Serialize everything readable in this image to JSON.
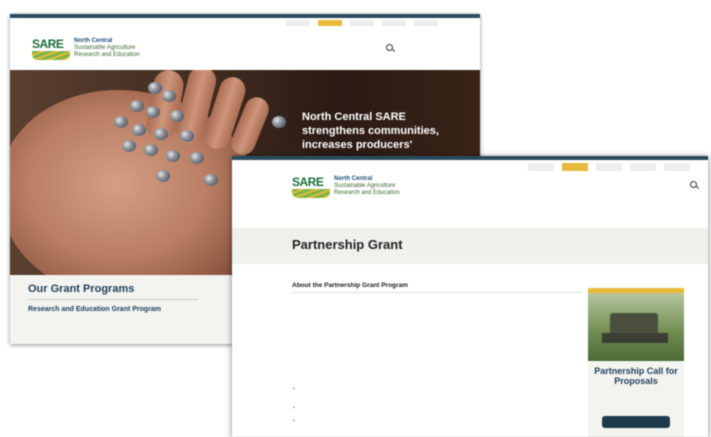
{
  "back_window": {
    "utility_tabs": [
      "",
      "",
      "",
      "",
      ""
    ],
    "logo": {
      "mark": "SARE",
      "line1": "North Central",
      "line2": "Sustainable Agriculture",
      "line3": "Research and Education"
    },
    "search": {
      "label1": "",
      "label2": ""
    },
    "nav_items": [
      "",
      "",
      "",
      "",
      ""
    ],
    "hero_text": "North Central SARE strengthens communities, increases producers'",
    "grants": {
      "title": "Our Grant Programs",
      "item": "Research and Education Grant Program",
      "desc": "",
      "link": ""
    }
  },
  "front_window": {
    "utility_tabs": [
      "",
      "",
      "",
      "",
      ""
    ],
    "logo": {
      "mark": "SARE",
      "line1": "North Central",
      "line2": "Sustainable Agriculture",
      "line3": "Research and Education"
    },
    "nav_items": [
      "",
      "",
      "",
      "",
      ""
    ],
    "breadcrumb": "",
    "page_title": "Partnership Grant",
    "about_heading": "About the Partnership Grant Program",
    "paragraphs": [
      "",
      "",
      ""
    ],
    "bullets": [
      "",
      "",
      ""
    ],
    "card": {
      "title": "Partnership Call for Proposals",
      "subtitle": "",
      "button": ""
    }
  },
  "colors": {
    "accent": "#e8b93a",
    "navy": "#1e3f5a",
    "green": "#1e6b3c"
  }
}
